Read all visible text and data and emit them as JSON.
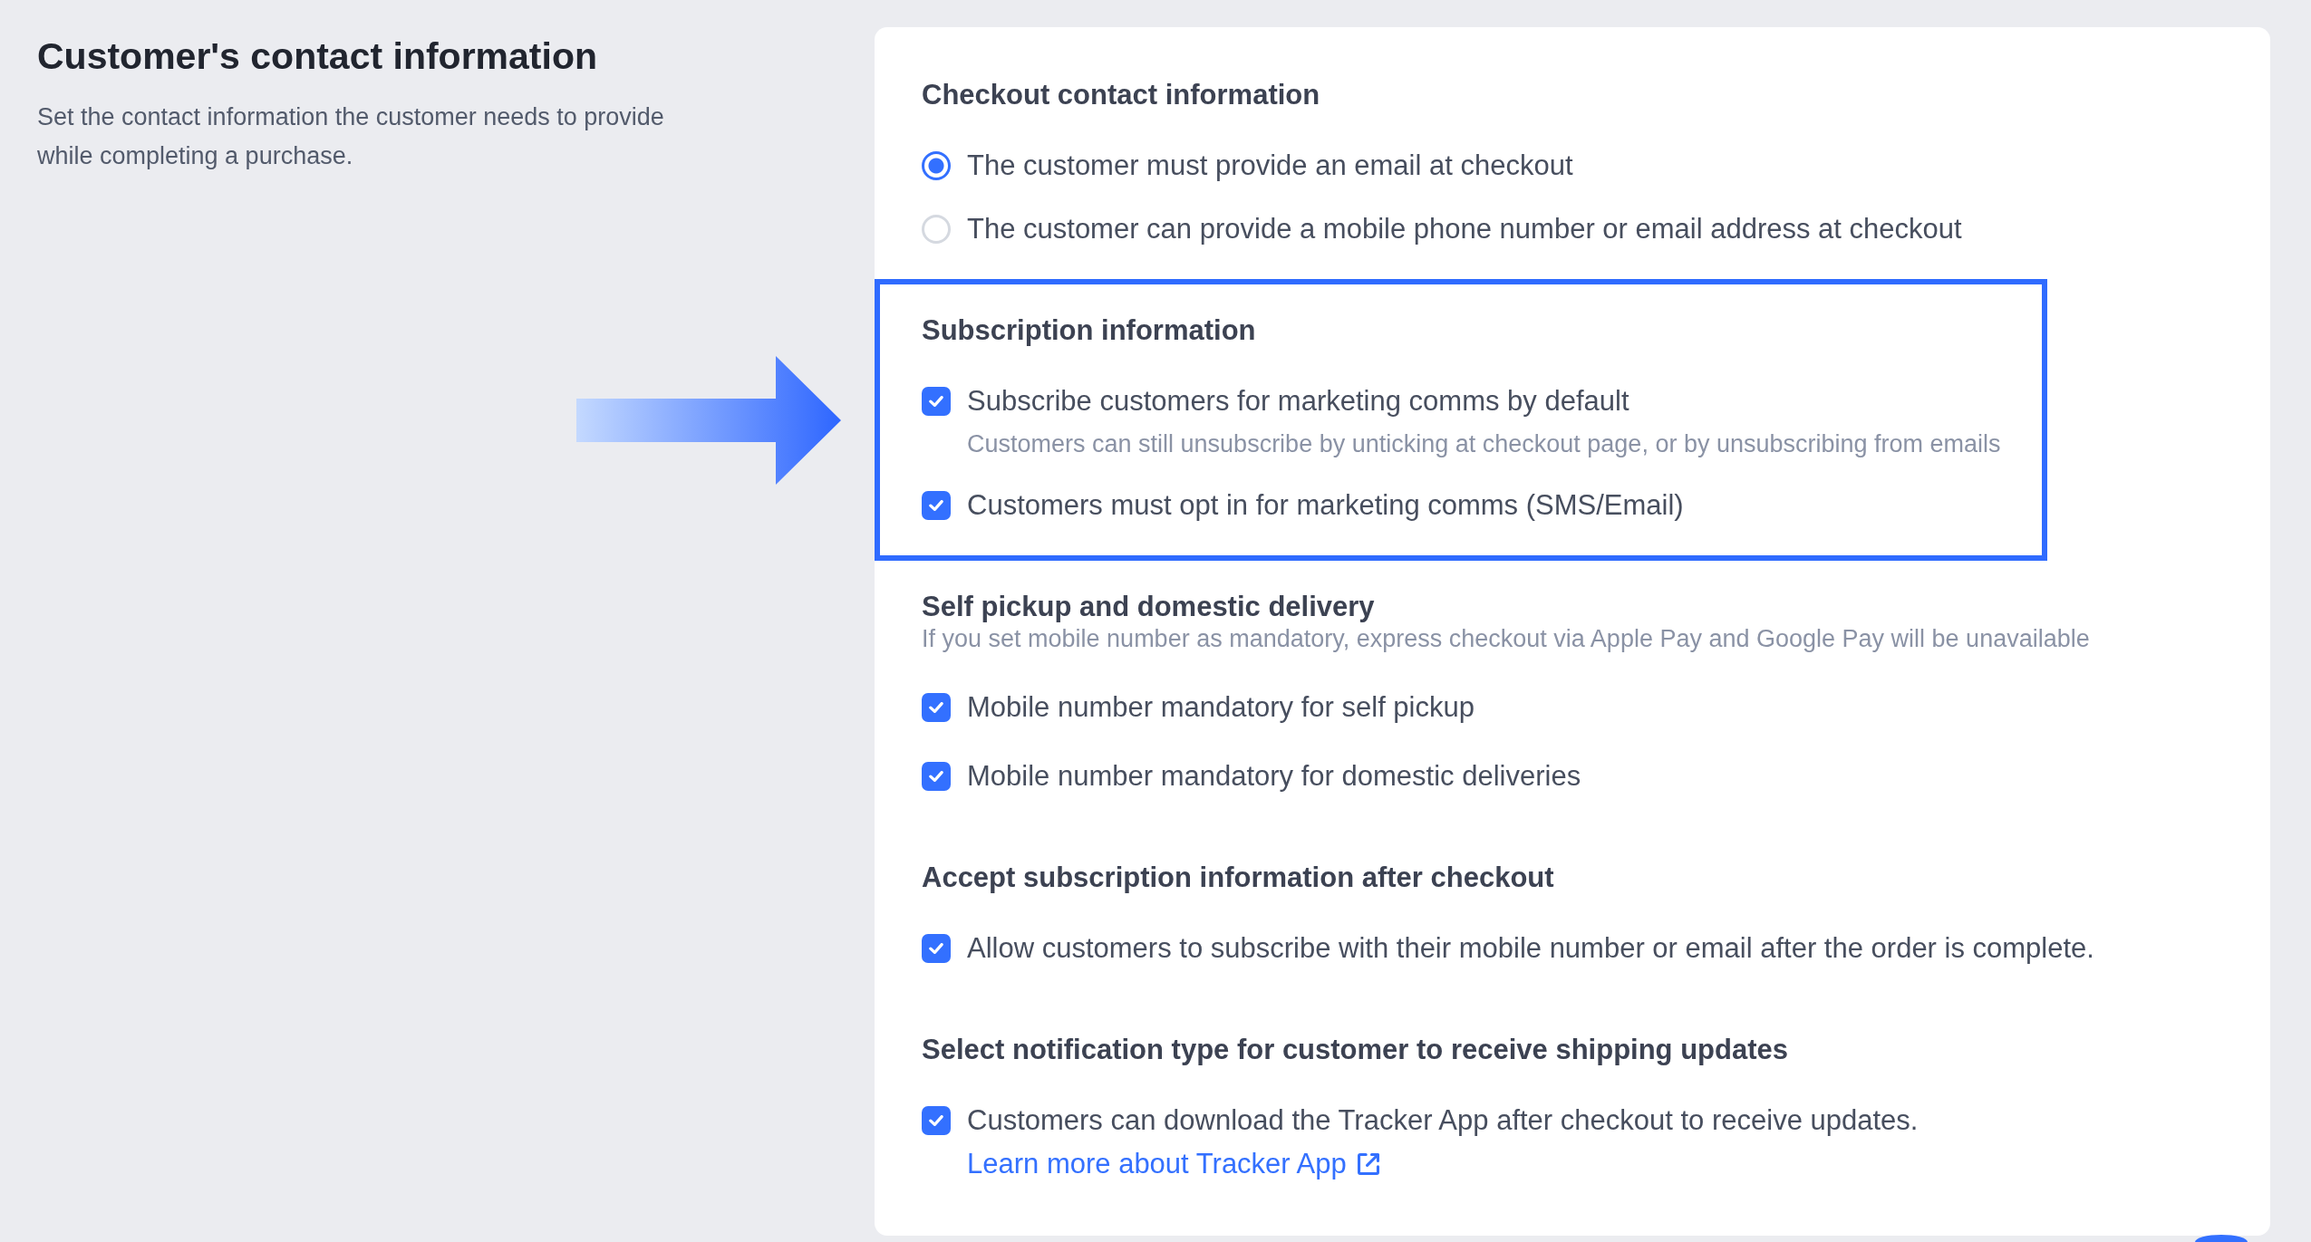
{
  "header": {
    "title": "Customer's contact information",
    "description": "Set the contact information the customer needs to provide while completing a purchase."
  },
  "sections": [
    {
      "kind": "radio",
      "title": "Checkout contact information",
      "highlighted": false,
      "options": [
        {
          "label": "The customer must provide an email at checkout",
          "selected": true
        },
        {
          "label": "The customer can provide a mobile phone number or email address at checkout",
          "selected": false
        }
      ]
    },
    {
      "kind": "checkbox",
      "title": "Subscription information",
      "highlighted": true,
      "options": [
        {
          "label": "Subscribe customers for marketing comms by default",
          "checked": true,
          "hint": "Customers can still unsubscribe by unticking at checkout page, or by unsubscribing from emails"
        },
        {
          "label": "Customers must opt in for marketing comms (SMS/Email)",
          "checked": true
        }
      ]
    },
    {
      "kind": "checkbox",
      "title": "Self pickup and domestic delivery",
      "hint": "If you set mobile number as mandatory, express checkout via Apple Pay and Google Pay will be unavailable",
      "highlighted": false,
      "options": [
        {
          "label": "Mobile number mandatory for self pickup",
          "checked": true
        },
        {
          "label": "Mobile number mandatory for domestic deliveries",
          "checked": true
        }
      ]
    },
    {
      "kind": "checkbox",
      "title": "Accept subscription information after checkout",
      "highlighted": false,
      "options": [
        {
          "label": "Allow customers to subscribe with their mobile number or email after the order is complete.",
          "checked": true
        }
      ]
    },
    {
      "kind": "checkbox",
      "title": "Select notification type for customer to receive shipping updates",
      "highlighted": false,
      "options": [
        {
          "label": "Customers can download the Tracker App after checkout to receive updates.",
          "link": "Learn more about Tracker App",
          "checked": true
        }
      ]
    }
  ]
}
